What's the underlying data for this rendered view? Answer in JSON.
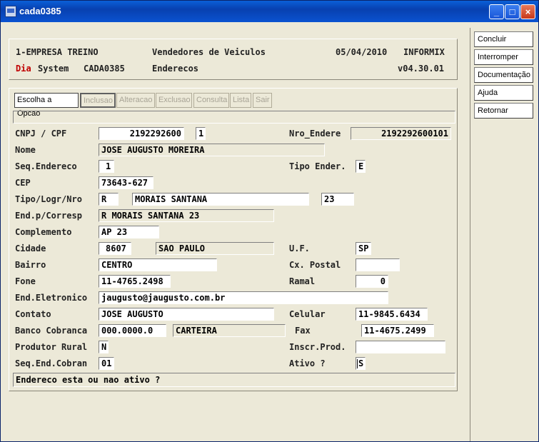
{
  "window": {
    "title": "cada0385",
    "minimize": "_",
    "maximize": "□",
    "close": "×"
  },
  "header": {
    "company": "1-EMPRESA TREINO",
    "module": "Vendedores de Veiculos",
    "date": "05/04/2010",
    "db": "INFORMIX",
    "dia": "Dia",
    "system": "System",
    "program": "CADA0385",
    "screen": "Enderecos",
    "version": "v04.30.01"
  },
  "options": [
    "Escolha a Opcao",
    "Inclusao",
    "Alteracao",
    "Exclusao",
    "Consulta",
    "Lista",
    "Sair"
  ],
  "side_buttons": [
    "Concluir",
    "Interromper",
    "Documentação",
    "Ajuda",
    "Retornar"
  ],
  "labels": {
    "cnpj": "CNPJ / CPF",
    "nro_endere": "Nro_Endere",
    "nome": "Nome",
    "seq_endereco": "Seq.Endereco",
    "tipo_ender": "Tipo Ender.",
    "cep": "CEP",
    "tipo_logr": "Tipo/Logr/Nro",
    "end_corresp": "End.p/Corresp",
    "complemento": "Complemento",
    "cidade": "Cidade",
    "uf": "U.F.",
    "bairro": "Bairro",
    "cx_postal": "Cx. Postal",
    "fone": "Fone",
    "ramal": "Ramal",
    "end_eletronico": "End.Eletronico",
    "contato": "Contato",
    "celular": "Celular",
    "banco": "Banco Cobranca",
    "fax": "Fax",
    "produtor": "Produtor Rural",
    "inscr": "Inscr.Prod.",
    "seq_cobran": "Seq.End.Cobran",
    "ativo": "Ativo ?"
  },
  "fields": {
    "cnpj": "2192292600",
    "cnpj_suffix": "1",
    "nro_endere": "2192292600101",
    "nome": "JOSE AUGUSTO MOREIRA",
    "seq_endereco": "1",
    "tipo_ender": "E",
    "cep": "73643-627",
    "tipo": "R",
    "logradouro": "MORAIS SANTANA",
    "numero": "23",
    "end_corresp": "R MORAIS SANTANA 23",
    "complemento": "AP 23",
    "cidade_cod": "8607",
    "cidade_nome": "SAO PAULO",
    "uf": "SP",
    "bairro": "CENTRO",
    "cx_postal": "",
    "fone": "11-4765.2498",
    "ramal": "0",
    "end_eletronico": "jaugusto@jaugusto.com.br",
    "contato": "JOSE AUGUSTO",
    "celular": "11-9845.6434",
    "banco": "000.0000.0",
    "banco_carteira": "CARTEIRA",
    "fax": "11-4675.2499",
    "produtor": "N",
    "inscr": "",
    "seq_cobran": "01",
    "ativo": "S"
  },
  "message": "Endereco esta ou nao ativo ?"
}
